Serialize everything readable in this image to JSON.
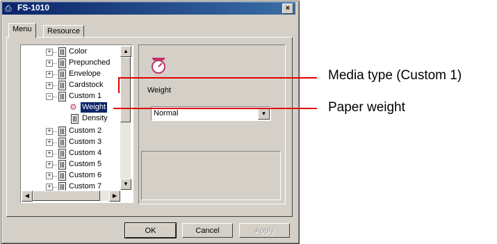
{
  "window": {
    "title": "FS-1010"
  },
  "tabs": [
    {
      "label": "Menu"
    },
    {
      "label": "Resource"
    }
  ],
  "tree": {
    "items": [
      {
        "label": "Color",
        "expander": "+"
      },
      {
        "label": "Prepunched",
        "expander": "+"
      },
      {
        "label": "Envelope",
        "expander": "+"
      },
      {
        "label": "Cardstock",
        "expander": "+"
      },
      {
        "label": "Custom 1",
        "expander": "-"
      },
      {
        "label": "Weight",
        "selected": true
      },
      {
        "label": "Density"
      },
      {
        "label": "Custom 2",
        "expander": "+"
      },
      {
        "label": "Custom 3",
        "expander": "+"
      },
      {
        "label": "Custom 4",
        "expander": "+"
      },
      {
        "label": "Custom 5",
        "expander": "+"
      },
      {
        "label": "Custom 6",
        "expander": "+"
      },
      {
        "label": "Custom 7",
        "expander": "+"
      }
    ]
  },
  "panel": {
    "heading": "Weight",
    "weight_select": {
      "value": "Normal"
    }
  },
  "buttons": {
    "ok": "OK",
    "cancel": "Cancel",
    "apply": "Apply"
  },
  "callouts": {
    "media_type": "Media type (Custom 1)",
    "paper_weight": "Paper weight"
  },
  "colors": {
    "titlebar": "#0a246a",
    "callout_line": "#e00000",
    "selection": "#0a246a"
  }
}
